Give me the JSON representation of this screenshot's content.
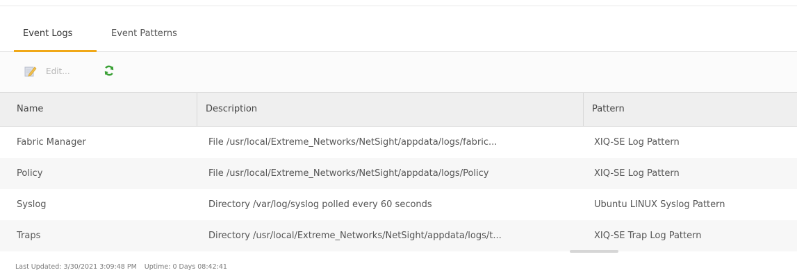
{
  "tabs": [
    {
      "label": "Event Logs",
      "active": true
    },
    {
      "label": "Event Patterns",
      "active": false
    }
  ],
  "toolbar": {
    "edit_label": "Edit...",
    "edit_icon": "edit-icon",
    "refresh_icon": "refresh-icon",
    "accent_color": "#f0a818",
    "refresh_color": "#3aa035"
  },
  "table": {
    "columns": [
      "Name",
      "Description",
      "Pattern"
    ],
    "rows": [
      {
        "name": "Fabric Manager",
        "description": "File /usr/local/Extreme_Networks/NetSight/appdata/logs/fabric...",
        "pattern": "XIQ-SE Log Pattern"
      },
      {
        "name": "Policy",
        "description": "File /usr/local/Extreme_Networks/NetSight/appdata/logs/Policy",
        "pattern": "XIQ-SE Log Pattern"
      },
      {
        "name": "Syslog",
        "description": "Directory /var/log/syslog polled every 60 seconds",
        "pattern": "Ubuntu LINUX Syslog Pattern"
      },
      {
        "name": "Traps",
        "description": "Directory /usr/local/Extreme_Networks/NetSight/appdata/logs/t...",
        "pattern": "XIQ-SE Trap Log Pattern"
      }
    ]
  },
  "status": {
    "last_updated": "Last Updated: 3/30/2021 3:09:48 PM",
    "uptime": "Uptime: 0 Days 08:42:41"
  }
}
